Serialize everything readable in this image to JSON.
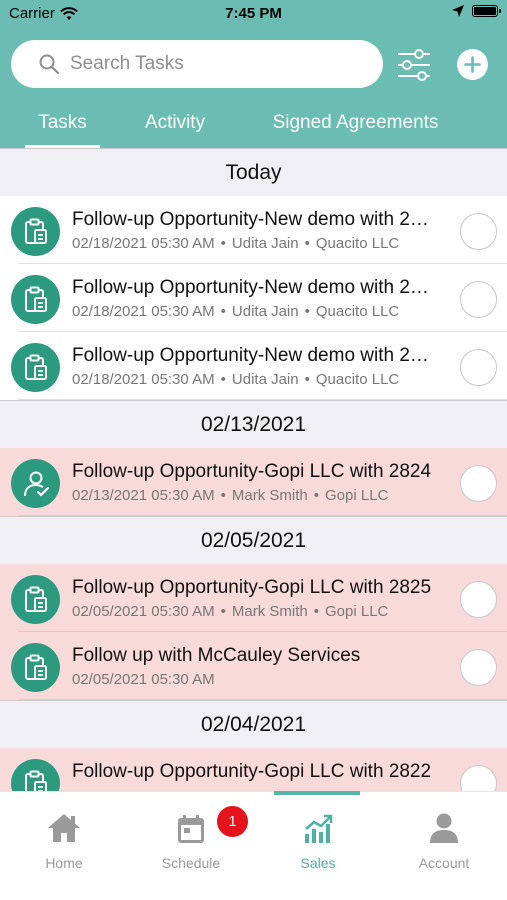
{
  "status_bar": {
    "carrier": "Carrier",
    "time": "7:45 PM"
  },
  "search": {
    "placeholder": "Search Tasks"
  },
  "tabs": [
    {
      "label": "Tasks",
      "active": true
    },
    {
      "label": "Activity",
      "active": false
    },
    {
      "label": "Signed Agreements",
      "active": false
    }
  ],
  "colors": {
    "header": "#6bbdb3",
    "icon_circle": "#2b9a7e",
    "overdue_row": "#f8dadb",
    "badge": "#e5131b",
    "active_tab": "#4fb0a3"
  },
  "sections": [
    {
      "label": "Today",
      "items": [
        {
          "title": "Follow-up Opportunity-New demo with 2…",
          "date": "02/18/2021 05:30 AM",
          "person": "Udita Jain",
          "company": "Quacito LLC",
          "icon": "clipboard-icon",
          "overdue": false
        },
        {
          "title": "Follow-up Opportunity-New demo with 2…",
          "date": "02/18/2021 05:30 AM",
          "person": "Udita Jain",
          "company": "Quacito LLC",
          "icon": "clipboard-icon",
          "overdue": false
        },
        {
          "title": "Follow-up Opportunity-New demo with 2…",
          "date": "02/18/2021 05:30 AM",
          "person": "Udita Jain",
          "company": "Quacito LLC",
          "icon": "clipboard-icon",
          "overdue": false
        }
      ]
    },
    {
      "label": "02/13/2021",
      "items": [
        {
          "title": "Follow-up Opportunity-Gopi LLC with 2824",
          "date": "02/13/2021 05:30 AM",
          "person": "Mark Smith",
          "company": "Gopi LLC",
          "icon": "user-check-icon",
          "overdue": true
        }
      ]
    },
    {
      "label": "02/05/2021",
      "items": [
        {
          "title": "Follow-up Opportunity-Gopi LLC with 2825",
          "date": "02/05/2021 05:30 AM",
          "person": "Mark Smith",
          "company": "Gopi LLC",
          "icon": "clipboard-icon",
          "overdue": true
        },
        {
          "title": "Follow up with McCauley Services",
          "date": "02/05/2021 05:30 AM",
          "person": "",
          "company": "",
          "icon": "clipboard-icon",
          "overdue": true
        }
      ]
    },
    {
      "label": "02/04/2021",
      "items": [
        {
          "title": "Follow-up Opportunity-Gopi LLC with 2822",
          "date": "",
          "person": "",
          "company": "",
          "icon": "clipboard-icon",
          "overdue": true
        }
      ]
    }
  ],
  "tabbar": {
    "items": [
      {
        "label": "Home",
        "icon": "home-icon",
        "active": false
      },
      {
        "label": "Schedule",
        "icon": "calendar-icon",
        "active": false,
        "badge": "1"
      },
      {
        "label": "Sales",
        "icon": "chart-icon",
        "active": true
      },
      {
        "label": "Account",
        "icon": "person-icon",
        "active": false
      }
    ]
  }
}
